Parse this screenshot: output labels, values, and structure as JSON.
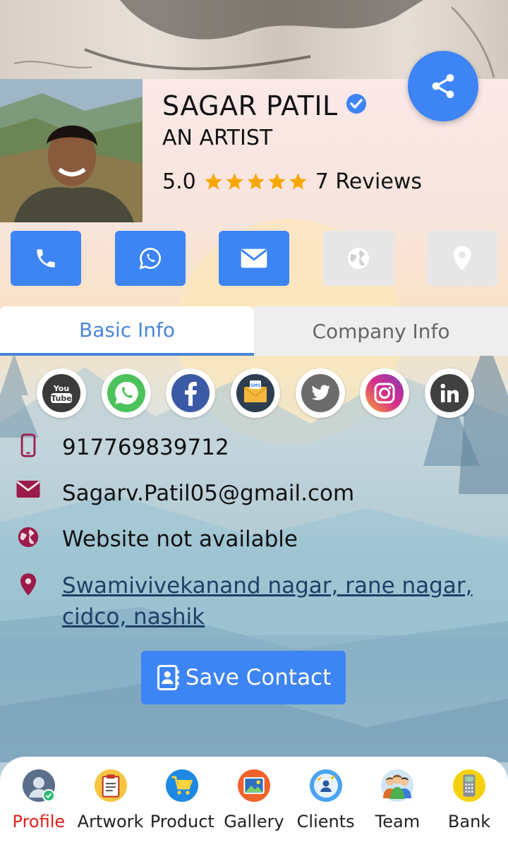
{
  "profile": {
    "name": "SAGAR PATIL",
    "title": "AN ARTIST",
    "rating": "5.0",
    "reviews": "7 Reviews",
    "verified_icon": "verified-badge-icon"
  },
  "actions": [
    {
      "name": "call",
      "icon": "phone-icon",
      "enabled": true
    },
    {
      "name": "whatsapp",
      "icon": "whatsapp-icon",
      "enabled": true
    },
    {
      "name": "email",
      "icon": "envelope-icon",
      "enabled": true
    },
    {
      "name": "website",
      "icon": "globe-icon",
      "enabled": false
    },
    {
      "name": "location",
      "icon": "map-pin-icon",
      "enabled": false
    }
  ],
  "tabs": {
    "basic": "Basic Info",
    "company": "Company Info",
    "active": "basic"
  },
  "social": [
    "youtube-icon",
    "whatsapp-icon",
    "facebook-icon",
    "sms-icon",
    "twitter-icon",
    "instagram-icon",
    "linkedin-icon"
  ],
  "contact": {
    "phone": "917769839712",
    "email": "Sagarv.Patil05@gmail.com",
    "website": "Website not available",
    "address_line1": "Swamivivekanand nagar, rane nagar,",
    "address_line2": "cidco, nashik"
  },
  "save_contact": "Save Contact",
  "bottom_nav": [
    {
      "label": "Profile",
      "active": true
    },
    {
      "label": "Artwork"
    },
    {
      "label": "Product"
    },
    {
      "label": "Gallery"
    },
    {
      "label": "Clients"
    },
    {
      "label": "Team"
    },
    {
      "label": "Bank"
    }
  ],
  "colors": {
    "primary": "#3d84f5",
    "tab_active": "#4a86d8",
    "icon_maroon": "#9b1b4a",
    "active_nav": "#e02020",
    "star": "#f6a800"
  }
}
